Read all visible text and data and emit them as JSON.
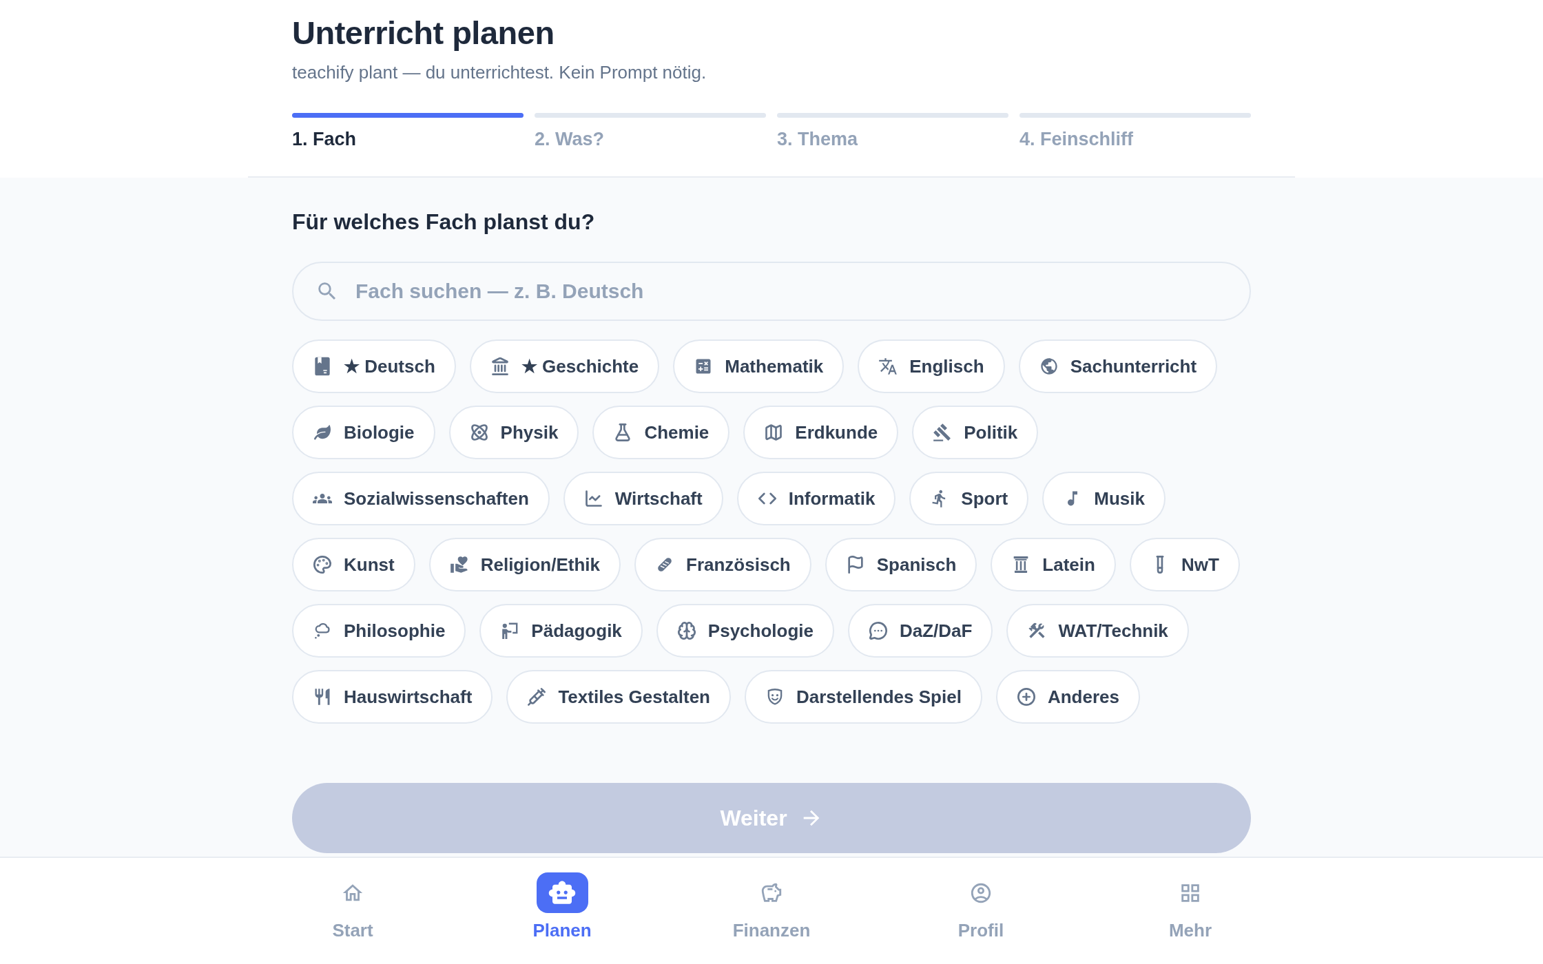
{
  "page": {
    "title": "Unterricht planen",
    "subtitle": "teachify plant — du unterrichtest. Kein Prompt nötig."
  },
  "steps": [
    {
      "label": "1. Fach",
      "selected": true
    },
    {
      "label": "2. Was?",
      "selected": false
    },
    {
      "label": "3. Thema",
      "selected": false
    },
    {
      "label": "4. Feinschliff",
      "selected": false
    }
  ],
  "question": "Für welches Fach planst du?",
  "search": {
    "placeholder": "Fach suchen — z. B. Deutsch"
  },
  "subject_rows": [
    {
      "subjects": [
        {
          "label": "★ Deutsch",
          "selected": false
        },
        {
          "label": "★ Geschichte",
          "selected": false
        },
        {
          "label": "Mathematik",
          "selected": false
        },
        {
          "label": "Englisch",
          "selected": false
        },
        {
          "label": "Sachunterricht",
          "selected": false
        }
      ]
    },
    {
      "subjects": [
        {
          "label": "Biologie",
          "selected": false
        },
        {
          "label": "Physik",
          "selected": false
        },
        {
          "label": "Chemie",
          "selected": false
        },
        {
          "label": "Erdkunde",
          "selected": false
        },
        {
          "label": "Politik",
          "selected": false
        }
      ]
    },
    {
      "subjects": [
        {
          "label": "Sozialwissenschaften",
          "selected": false
        },
        {
          "label": "Wirtschaft",
          "selected": false
        },
        {
          "label": "Informatik",
          "selected": false
        },
        {
          "label": "Sport",
          "selected": false
        },
        {
          "label": "Musik",
          "selected": false
        }
      ]
    },
    {
      "subjects": [
        {
          "label": "Kunst",
          "selected": false
        },
        {
          "label": "Religion/Ethik",
          "selected": false
        },
        {
          "label": "Französisch",
          "selected": false
        },
        {
          "label": "Spanisch",
          "selected": false
        },
        {
          "label": "Latein",
          "selected": false
        },
        {
          "label": "NwT",
          "selected": false
        }
      ]
    },
    {
      "subjects": [
        {
          "label": "Philosophie",
          "selected": false
        },
        {
          "label": "Pädagogik",
          "selected": false
        },
        {
          "label": "Psychologie",
          "selected": false
        },
        {
          "label": "DaZ/DaF",
          "selected": false
        },
        {
          "label": "WAT/Technik",
          "selected": false
        }
      ]
    },
    {
      "subjects": [
        {
          "label": "Hauswirtschaft",
          "selected": false
        },
        {
          "label": "Textiles Gestalten",
          "selected": false
        },
        {
          "label": "Darstellendes Spiel",
          "selected": false
        },
        {
          "label": "Anderes",
          "selected": false
        }
      ]
    }
  ],
  "continue_button": {
    "label": "Weiter",
    "disabled": true
  },
  "nav": [
    {
      "label": "Start",
      "selected": false
    },
    {
      "label": "Planen",
      "selected": true
    },
    {
      "label": "Finanzen",
      "selected": false
    },
    {
      "label": "Profil",
      "selected": false
    },
    {
      "label": "Mehr",
      "selected": false
    }
  ]
}
